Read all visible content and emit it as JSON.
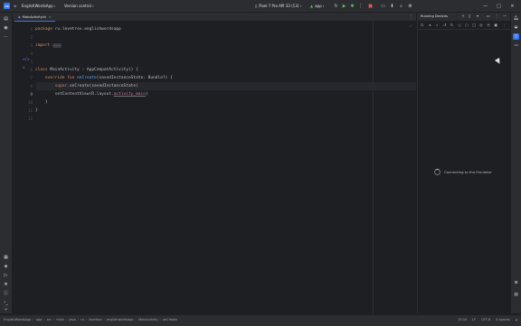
{
  "titlebar": {
    "logo": "AS",
    "project": "EnglishWordsApp",
    "vcs": "Version control",
    "device": "Pixel 7 Pro API 33 (13)",
    "run_config": "app"
  },
  "tabs": [
    {
      "label": "MainActivity.kt"
    }
  ],
  "editor": {
    "lines": [
      {
        "n": "1",
        "parts": [
          {
            "c": "kw",
            "t": "package "
          },
          {
            "c": "pk",
            "t": "ru.levetrov.englishwordsapp"
          }
        ]
      },
      {
        "n": "2",
        "parts": []
      },
      {
        "n": "3",
        "parts": [
          {
            "c": "kw",
            "t": "import "
          },
          {
            "c": "fold",
            "t": "..."
          }
        ]
      },
      {
        "n": "4",
        "parts": []
      },
      {
        "n": "5",
        "parts": []
      },
      {
        "n": "6",
        "parts": [
          {
            "c": "kw",
            "t": "class "
          },
          {
            "c": "pk",
            "t": "MainActivity : AppCompatActivity() {"
          }
        ]
      },
      {
        "n": "7",
        "parts": [
          {
            "c": "pk",
            "t": "    "
          },
          {
            "c": "kw",
            "t": "override fun "
          },
          {
            "c": "fn",
            "t": "onCreate"
          },
          {
            "c": "pk",
            "t": "(savedInstanceState: Bundle?) {"
          }
        ]
      },
      {
        "n": "8",
        "parts": [
          {
            "c": "pk",
            "t": "        "
          },
          {
            "c": "kw",
            "t": "super"
          },
          {
            "c": "pk",
            "t": ".onCreate(savedInstanceState)"
          }
        ]
      },
      {
        "n": "9",
        "parts": [
          {
            "c": "pk",
            "t": "        setContentView(R.layout."
          },
          {
            "c": "res",
            "t": "activity_main"
          },
          {
            "c": "pk",
            "t": ")"
          }
        ]
      },
      {
        "n": "10",
        "parts": [
          {
            "c": "pk",
            "t": "    }"
          }
        ]
      },
      {
        "n": "11",
        "parts": [
          {
            "c": "pk",
            "t": "}"
          }
        ]
      },
      {
        "n": "12",
        "parts": []
      }
    ]
  },
  "panel": {
    "title": "Running Devices",
    "status": "Connecting to the Emulator"
  },
  "statusbar": {
    "breadcrumbs": [
      "EnglishWordsApp",
      "app",
      "src",
      "main",
      "java",
      "ru",
      "levetrov",
      "englishwordsapp",
      "MainActivity",
      "onCreate"
    ],
    "right": [
      "10:34",
      "LF",
      "UTF-8",
      "4 spaces"
    ]
  },
  "icons": {
    "accent": "#3574f0"
  }
}
